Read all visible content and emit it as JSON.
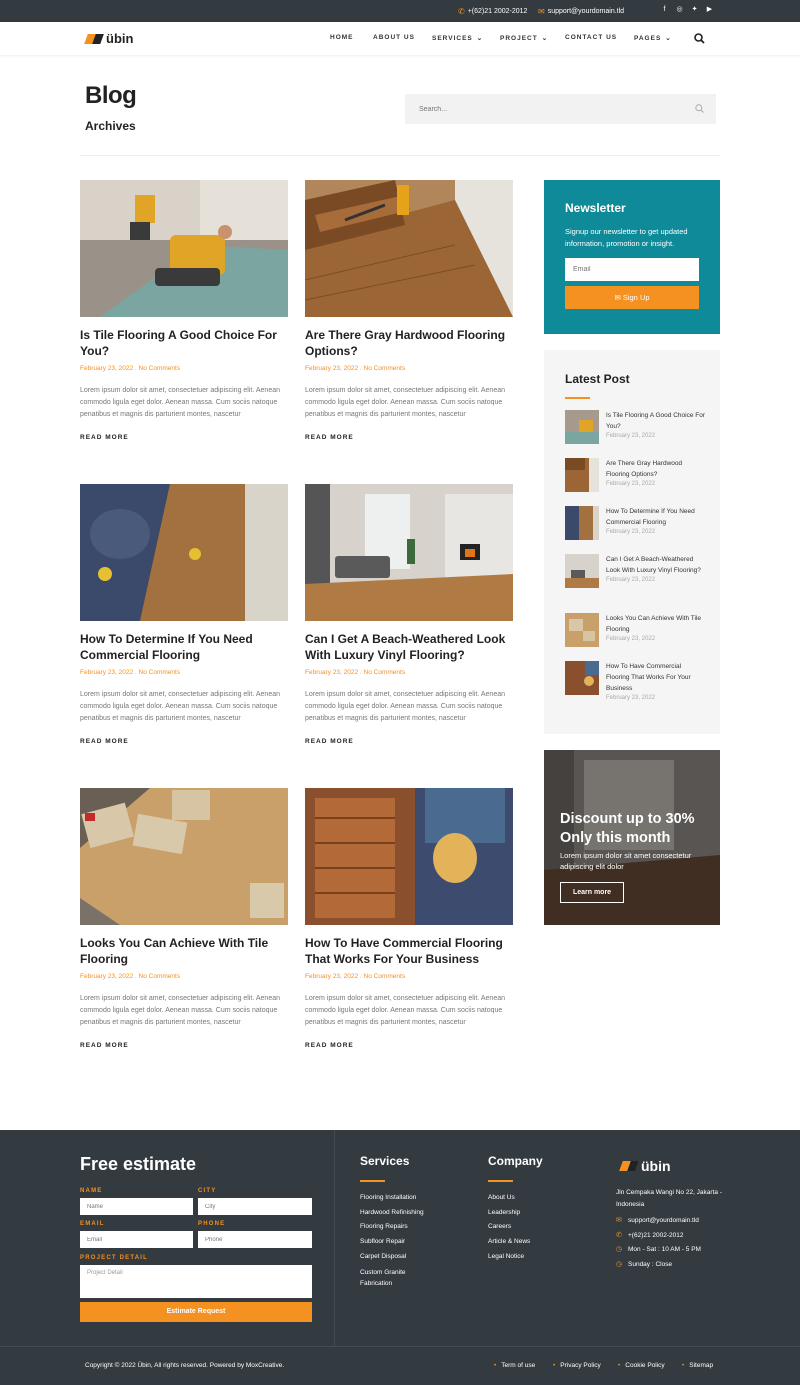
{
  "topbar": {
    "phone": "+(62)21 2002-2012",
    "email": "support@yourdomain.tld",
    "social": [
      "facebook-icon",
      "instagram-icon",
      "twitter-icon",
      "youtube-icon"
    ]
  },
  "brand": {
    "name": "übin",
    "accent": "#f59120",
    "dark": "#333a40",
    "teal": "#0e8a99"
  },
  "nav": {
    "items": [
      "HOME",
      "ABOUT US",
      "SERVICES",
      "PROJECT",
      "CONTACT US",
      "PAGES"
    ]
  },
  "header": {
    "title": "Blog",
    "subtitle": "Archives",
    "search_placeholder": "Search..."
  },
  "posts": [
    {
      "title": "Is Tile Flooring A Good Choice For You?",
      "date": "February 23, 2022",
      "comments": "No Comments",
      "excerpt": "Lorem ipsum dolor sit amet, consectetuer adipiscing elit. Aenean commodo ligula eget dolor. Aenean massa. Cum sociis natoque penatibus et magnis dis parturient montes, nascetur",
      "more": "READ MORE"
    },
    {
      "title": "Are There Gray Hardwood Flooring Options?",
      "date": "February 23, 2022",
      "comments": "No Comments",
      "excerpt": "Lorem ipsum dolor sit amet, consectetuer adipiscing elit. Aenean commodo ligula eget dolor. Aenean massa. Cum sociis natoque penatibus et magnis dis parturient montes, nascetur",
      "more": "READ MORE"
    },
    {
      "title": "How To Determine If You Need Commercial Flooring",
      "date": "February 23, 2022",
      "comments": "No Comments",
      "excerpt": "Lorem ipsum dolor sit amet, consectetuer adipiscing elit. Aenean commodo ligula eget dolor. Aenean massa. Cum sociis natoque penatibus et magnis dis parturient montes, nascetur",
      "more": "READ MORE"
    },
    {
      "title": "Can I Get A Beach-Weathered Look With Luxury Vinyl Flooring?",
      "date": "February 23, 2022",
      "comments": "No Comments",
      "excerpt": "Lorem ipsum dolor sit amet, consectetuer adipiscing elit. Aenean commodo ligula eget dolor. Aenean massa. Cum sociis natoque penatibus et magnis dis parturient montes, nascetur",
      "more": "READ MORE"
    },
    {
      "title": "Looks You Can Achieve With Tile Flooring",
      "date": "February 23, 2022",
      "comments": "No Comments",
      "excerpt": "Lorem ipsum dolor sit amet, consectetuer adipiscing elit. Aenean commodo ligula eget dolor. Aenean massa. Cum sociis natoque penatibus et magnis dis parturient montes, nascetur",
      "more": "READ MORE"
    },
    {
      "title": "How To Have Commercial Flooring That Works For Your Business",
      "date": "February 23, 2022",
      "comments": "No Comments",
      "excerpt": "Lorem ipsum dolor sit amet, consectetuer adipiscing elit. Aenean commodo ligula eget dolor. Aenean massa. Cum sociis natoque penatibus et magnis dis parturient montes, nascetur",
      "more": "READ MORE"
    }
  ],
  "newsletter": {
    "title": "Newsletter",
    "desc": "Signup our newsletter to get updated information, promotion or insight.",
    "email_placeholder": "Email",
    "button": "Sign Up"
  },
  "latest": {
    "title": "Latest Post",
    "items": [
      {
        "title": "Is Tile Flooring A Good Choice For You?",
        "date": "February 23, 2022"
      },
      {
        "title": "Are There Gray Hardwood Flooring Options?",
        "date": "February 23, 2022"
      },
      {
        "title": "How To Determine If You Need Commercial Flooring",
        "date": "February 23, 2022"
      },
      {
        "title": "Can I Get A Beach-Weathered Look With Luxury Vinyl Flooring?",
        "date": "February 23, 2022"
      },
      {
        "title": "Looks You Can Achieve With Tile Flooring",
        "date": "February 23, 2022"
      },
      {
        "title": "How To Have Commercial Flooring That Works For Your Business",
        "date": "February 23, 2022"
      }
    ]
  },
  "promo": {
    "headline": "Discount up to 30% Only this month",
    "desc": "Lorem ipsum dolor sit amet consectetur adipiscing elit dolor",
    "button": "Learn more"
  },
  "footer": {
    "estimate_title": "Free estimate",
    "labels": {
      "name": "NAME",
      "city": "CITY",
      "email": "EMAIL",
      "phone": "PHONE",
      "project": "PROJECT DETAIL"
    },
    "placeholders": {
      "name": "Name",
      "city": "City",
      "email": "Email",
      "phone": "Phone",
      "project": "Project Detail"
    },
    "submit": "Estimate Request",
    "services_title": "Services",
    "services": [
      "Flooring Installation",
      "Hardwood Refinishing",
      "Flooring Repairs",
      "Subfloor Repair",
      "Carpet Disposal",
      "Custom Granite Fabrication"
    ],
    "company_title": "Company",
    "company": [
      "About Us",
      "Leadership",
      "Careers",
      "Article & News",
      "Legal Notice"
    ],
    "address": "Jln Cempaka Wangi No 22, Jakarta - Indonesia",
    "email": "support@yourdomain.tld",
    "phone": "+(62)21 2002-2012",
    "hours": "Mon - Sat : 10 AM - 5 PM",
    "sunday": "Sunday : Close",
    "copyright": "Copyright © 2022 Übin, All rights reserved. Powered by MoxCreative.",
    "links": [
      "Term of use",
      "Privacy Policy",
      "Cookie Policy",
      "Sitemap"
    ]
  }
}
